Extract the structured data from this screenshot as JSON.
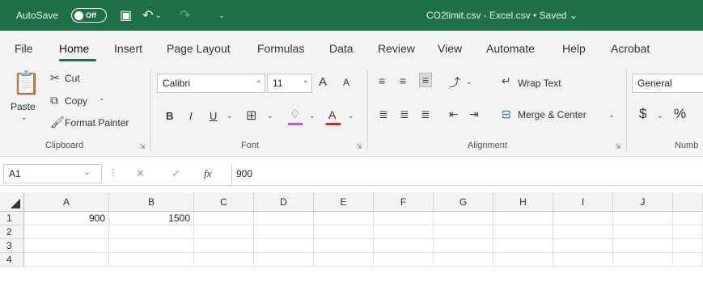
{
  "titlebar": {
    "autosave_label": "AutoSave",
    "autosave_state": "Off",
    "doc_title": "CO2limit.csv - Excel.csv • Saved ⌄"
  },
  "menu": {
    "tabs": [
      "File",
      "Home",
      "Insert",
      "Page Layout",
      "Formulas",
      "Data",
      "Review",
      "View",
      "Automate",
      "Help",
      "Acrobat"
    ]
  },
  "ribbon": {
    "clipboard": {
      "paste_label": "Paste",
      "cut_label": "Cut",
      "copy_label": "Copy",
      "format_painter_label": "Format Painter",
      "group_label": "Clipboard"
    },
    "font": {
      "font_name": "Calibri",
      "font_size": "11",
      "bold_label": "B",
      "italic_label": "I",
      "underline_label": "U",
      "font_color_label": "A",
      "grow_label": "A",
      "shrink_label": "A",
      "group_label": "Font"
    },
    "alignment": {
      "wrap_text_label": "Wrap Text",
      "merge_center_label": "Merge & Center",
      "group_label": "Alignment"
    },
    "number": {
      "format": "General",
      "currency_label": "$",
      "percent_label": "%",
      "group_label": "Numb"
    }
  },
  "formula_bar": {
    "name_box": "A1",
    "fx_label": "fx",
    "value": "900"
  },
  "sheet": {
    "columns": [
      "A",
      "B",
      "C",
      "D",
      "E",
      "F",
      "G",
      "H",
      "I",
      "J"
    ],
    "rows": [
      "1",
      "2",
      "3",
      "4"
    ],
    "cells": {
      "A1": "900",
      "B1": "1500"
    }
  },
  "colors": {
    "title_green": "#1e7145",
    "ribbon_bg": "#f3f3f3"
  }
}
